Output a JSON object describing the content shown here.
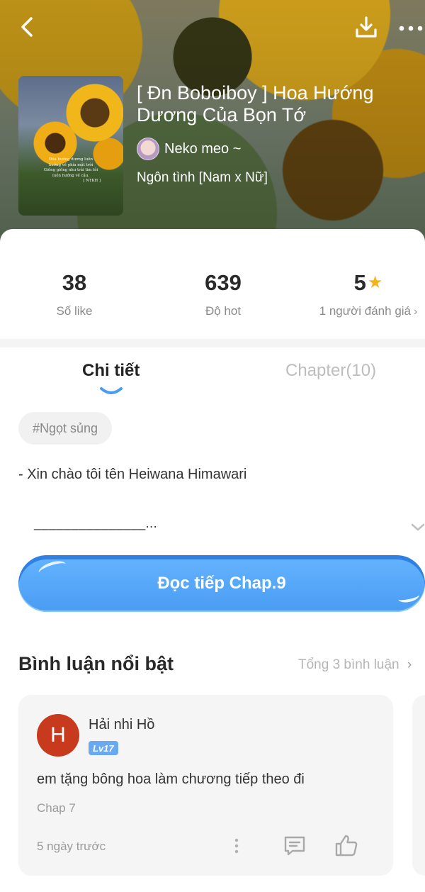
{
  "header": {
    "title": "[ Đn Boboiboy ] Hoa Hướng Dương Của Bọn Tớ",
    "author": "Neko meo ~",
    "genre": "Ngôn tình [Nam x Nữ]",
    "icons": {
      "back": "chevron-left-icon",
      "download": "download-icon",
      "more": "more-horizontal-icon"
    }
  },
  "cover": {
    "lines": [
      "Đóa hướng dương luôn",
      "hướng về phía mặt trời",
      "Giống giống như trái tim tôi",
      "luôn hướng về cậu.",
      "[ NTKH ]"
    ]
  },
  "stats": {
    "likes": {
      "value": "38",
      "label": "Số like"
    },
    "hot": {
      "value": "639",
      "label": "Độ hot"
    },
    "rating": {
      "value": "5",
      "label": "1 người đánh giá"
    }
  },
  "tabs": {
    "detail": "Chi tiết",
    "chapter": "Chapter(10)",
    "active": "detail"
  },
  "tag": "#Ngọt sủng",
  "description": {
    "line1": "- Xin chào tôi tên Heiwana Himawari",
    "line2": "_______________..."
  },
  "read_button": "Đọc tiếp Chap.9",
  "comments": {
    "heading": "Bình luận nổi bật",
    "total": "Tổng 3 bình luận",
    "items": [
      {
        "avatar_letter": "H",
        "name": "Hải nhi Hồ",
        "level": "Lv17",
        "text": "em tặng bông hoa làm chương tiếp theo đi",
        "chapter": "Chap 7",
        "time": "5 ngày trước"
      }
    ]
  },
  "colors": {
    "accent": "#4a9cf2",
    "star": "#f5b31b",
    "avatar_bg": "#c83a1d",
    "tab_inactive": "#bdbdbd"
  }
}
